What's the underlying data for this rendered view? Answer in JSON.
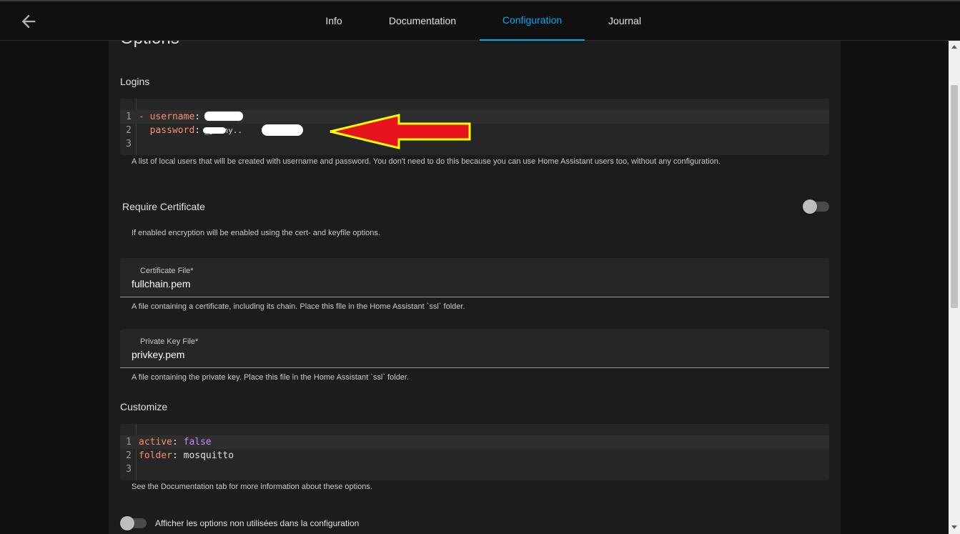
{
  "tabs": [
    {
      "label": "Info",
      "active": false
    },
    {
      "label": "Documentation",
      "active": false
    },
    {
      "label": "Configuration",
      "active": true
    },
    {
      "label": "Journal",
      "active": false
    }
  ],
  "options": {
    "title": "Options",
    "logins": {
      "title": "Logins",
      "line_numbers": [
        "1",
        "2",
        "3"
      ],
      "line1": {
        "dash": "- ",
        "key": "username",
        "sep": ": "
      },
      "line2": {
        "indent": "  ",
        "key": "password",
        "sep": ": ",
        "value_visible": "_jonny.."
      },
      "helper": "A list of local users that will be created with username and password. You don't need to do this because you can use Home Assistant users too, without any configuration."
    },
    "require_certificate": {
      "title": "Require Certificate",
      "enabled": false,
      "helper": "If enabled encryption will be enabled using the cert- and keyfile options."
    },
    "certfile": {
      "label": "Certificate File*",
      "value": "fullchain.pem",
      "helper": "A file containing a certificate, including its chain. Place this file in the Home Assistant `ssl` folder."
    },
    "keyfile": {
      "label": "Private Key File*",
      "value": "privkey.pem",
      "helper": "A file containing the private key. Place this file in the Home Assistant `ssl` folder."
    },
    "customize": {
      "title": "Customize",
      "line_numbers": [
        "1",
        "2",
        "3"
      ],
      "line1": {
        "key": "active",
        "sep": ": ",
        "value": "false"
      },
      "line2": {
        "key": "folder",
        "sep": ": ",
        "value": "mosquitto"
      },
      "helper": "See the Documentation tab for more information about these options."
    },
    "show_unused": {
      "label": "Afficher les options non utilisées dans la configuration",
      "enabled": false
    }
  },
  "colors": {
    "accent": "#03a9f4",
    "background": "#111111",
    "card": "#1c1c1c",
    "annotation_arrow_fill": "#e8141c",
    "annotation_arrow_stroke": "#ffff00"
  },
  "icons": {
    "back": "arrow-left-icon",
    "annotation": "arrow-left-annotation-icon"
  }
}
